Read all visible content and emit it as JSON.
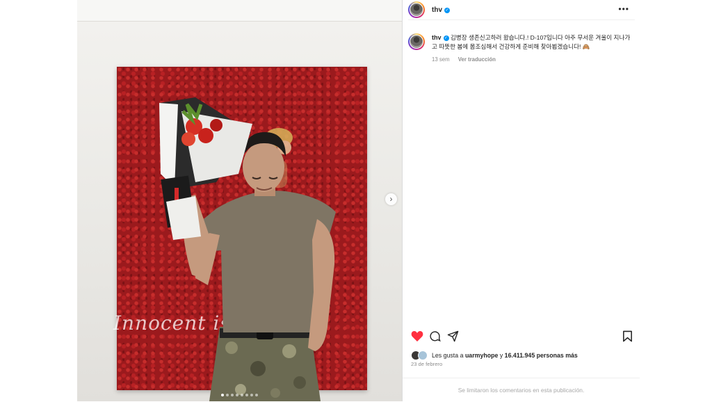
{
  "post": {
    "username": "thv",
    "verified": true,
    "caption": "김병장 생존신고하러 왔습니다.! D-107입니다 아주 무서운 겨울이 지나가고 따뜻한 봄에 몸조심해서 건강하게 준비해 찾아뵙겠습니다! 🙈",
    "time_ago": "13 sem",
    "translate_label": "Ver traducción",
    "likes_prefix": "Les gusta a",
    "liked_by_user": "uarmyhope",
    "likes_connector": "y",
    "likes_count_text": "16.411.945 personas más",
    "date": "23 de febrero",
    "comments_notice": "Se limitaron los comentarios en esta publicación.",
    "wall_text": "Innocent is  ...  ity",
    "media_slides": 8,
    "current_slide": 1
  },
  "icons": {
    "more": "more-options-icon",
    "like": "heart-icon",
    "comment": "comment-icon",
    "share": "share-icon",
    "save": "bookmark-icon",
    "next": "chevron-right-icon"
  },
  "colors": {
    "like_red": "#ff3040",
    "verified_blue": "#0095f6",
    "muted": "#8e8e8e"
  }
}
